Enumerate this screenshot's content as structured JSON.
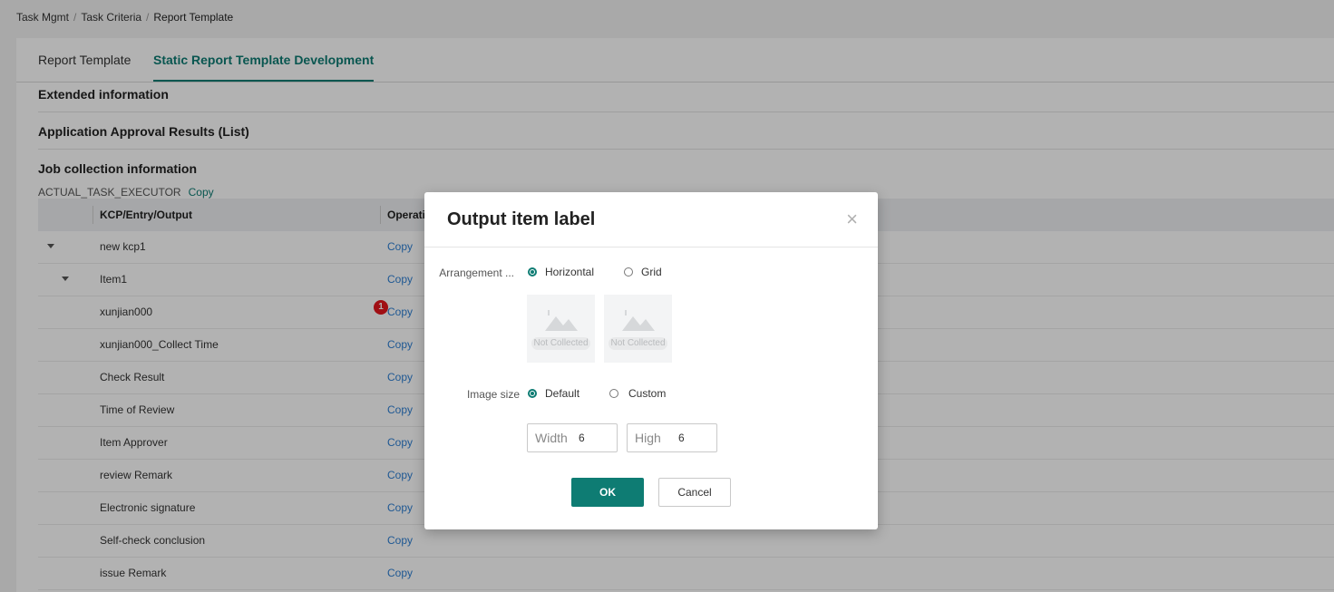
{
  "breadcrumb": [
    "Task Mgmt",
    "Task Criteria",
    "Report Template"
  ],
  "tabs": [
    {
      "label": "Report Template",
      "active": false
    },
    {
      "label": "Static Report Template Development",
      "active": true
    }
  ],
  "sections": {
    "extended": "Extended information",
    "approval": "Application Approval Results (List)",
    "job": "Job collection information"
  },
  "executor": {
    "label": "ACTUAL_TASK_EXECUTOR",
    "copy": "Copy"
  },
  "table": {
    "headers": [
      "KCP/Entry/Output",
      "Operati"
    ],
    "rows": [
      {
        "name": "new kcp1",
        "op": "Copy"
      },
      {
        "name": "Item1",
        "op": "Copy"
      },
      {
        "name": "xunjian000",
        "op": "Copy"
      },
      {
        "name": "xunjian000_Collect Time",
        "op": "Copy"
      },
      {
        "name": "Check Result",
        "op": "Copy"
      },
      {
        "name": "Time of Review",
        "op": "Copy"
      },
      {
        "name": "Item Approver",
        "op": "Copy"
      },
      {
        "name": "review Remark",
        "op": "Copy"
      },
      {
        "name": "Electronic signature",
        "op": "Copy"
      },
      {
        "name": "Self-check conclusion",
        "op": "Copy"
      },
      {
        "name": "issue Remark",
        "op": "Copy"
      }
    ],
    "badge": "1"
  },
  "modal": {
    "title": "Output item label",
    "close": "×",
    "arrangement_label": "Arrangement ...",
    "arrangement_options": [
      "Horizontal",
      "Grid"
    ],
    "arrangement_selected": "Horizontal",
    "thumb_text": "Not Collected",
    "image_size_label": "Image size",
    "image_size_options": [
      "Default",
      "Custom"
    ],
    "image_size_selected": "Default",
    "width_label": "Width",
    "width_value": "6",
    "high_label": "High",
    "high_value": "6",
    "ok": "OK",
    "cancel": "Cancel"
  },
  "colors": {
    "accent": "#0e7c73",
    "link": "#2d7fd3",
    "badge": "#e5161d"
  }
}
